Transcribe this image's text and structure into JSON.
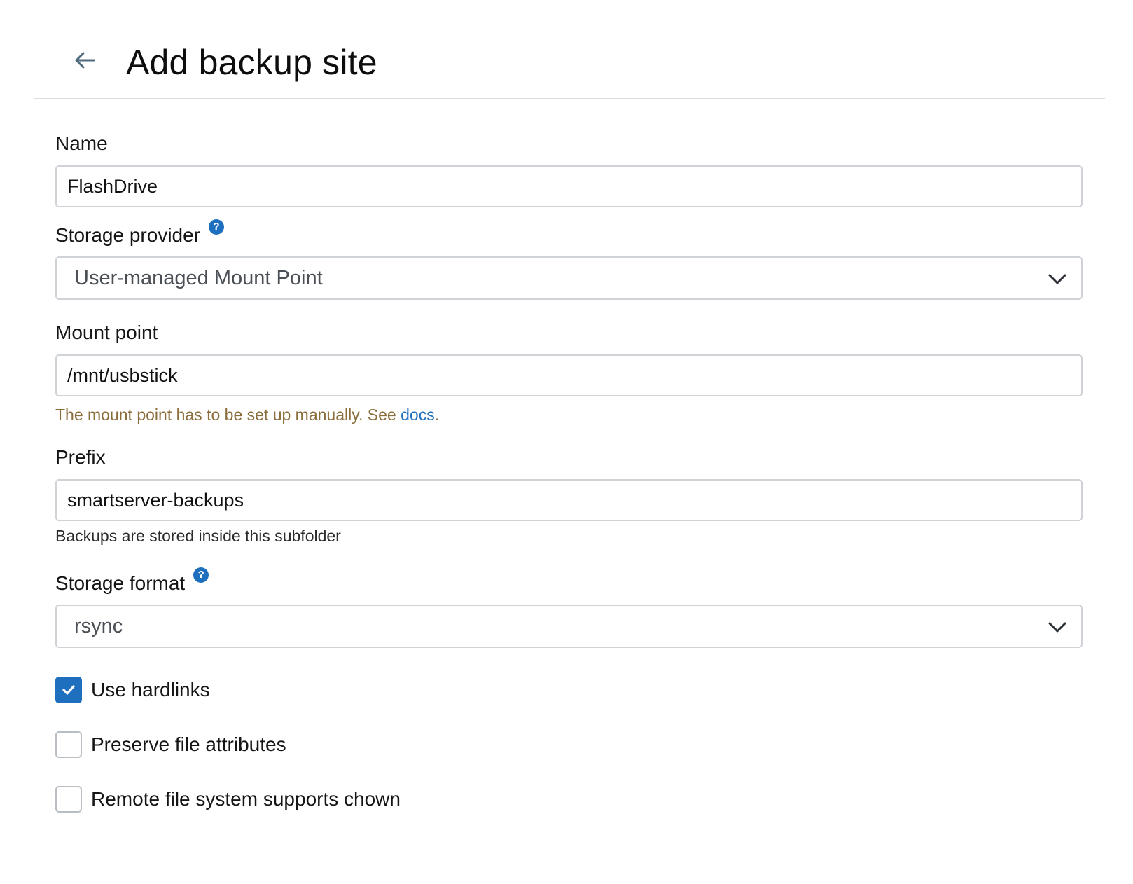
{
  "header": {
    "title": "Add backup site",
    "back_icon": "arrow-left-icon"
  },
  "fields": {
    "name": {
      "label": "Name",
      "value": "FlashDrive"
    },
    "storage_provider": {
      "label": "Storage provider",
      "help_glyph": "?",
      "selected": "User-managed Mount Point"
    },
    "mount_point": {
      "label": "Mount point",
      "value": "/mnt/usbstick",
      "warning_prefix": "The mount point has to be set up manually. See ",
      "warning_link": "docs",
      "warning_suffix": "."
    },
    "prefix": {
      "label": "Prefix",
      "value": "smartserver-backups",
      "helper": "Backups are stored inside this subfolder"
    },
    "storage_format": {
      "label": "Storage format",
      "help_glyph": "?",
      "selected": "rsync"
    }
  },
  "options": {
    "use_hardlinks": {
      "label": "Use hardlinks",
      "checked": true
    },
    "preserve_attributes": {
      "label": "Preserve file attributes",
      "checked": false
    },
    "supports_chown": {
      "label": "Remote file system supports chown",
      "checked": false
    }
  },
  "colors": {
    "accent": "#1f6fbf",
    "warning_text": "#8a6d3b",
    "border": "#cfd3d8",
    "divider": "#d9dce0"
  }
}
